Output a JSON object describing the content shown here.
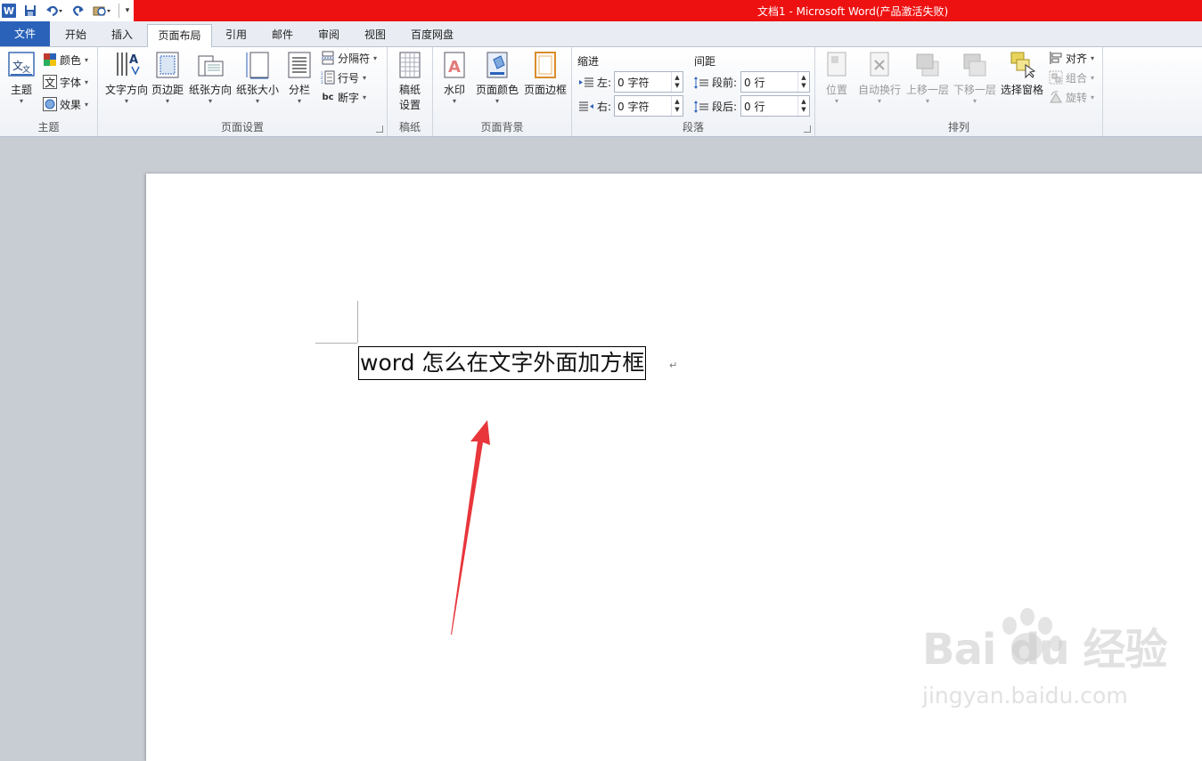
{
  "window": {
    "title": "文档1 - Microsoft Word(产品激活失败)"
  },
  "quick_access": {
    "app_icon": "W",
    "icons": [
      "save-icon",
      "undo-icon",
      "redo-icon",
      "print-preview-icon",
      "customize-icon"
    ]
  },
  "tabs": [
    {
      "label": "文件"
    },
    {
      "label": "开始"
    },
    {
      "label": "插入"
    },
    {
      "label": "页面布局"
    },
    {
      "label": "引用"
    },
    {
      "label": "邮件"
    },
    {
      "label": "审阅"
    },
    {
      "label": "视图"
    },
    {
      "label": "百度网盘"
    }
  ],
  "ribbon": {
    "theme_group": {
      "label": "主题",
      "theme_button": "主题",
      "colors": "颜色",
      "fonts": "字体",
      "effects": "效果"
    },
    "page_setup_group": {
      "label": "页面设置",
      "text_direction": "文字方向",
      "margins": "页边距",
      "orientation": "纸张方向",
      "size": "纸张大小",
      "columns": "分栏",
      "breaks": "分隔符",
      "line_numbers": "行号",
      "hyphenation": "断字",
      "hyphenation_icon_text": "bc"
    },
    "manuscript_group": {
      "label": "稿纸",
      "settings_line1": "稿纸",
      "settings_line2": "设置"
    },
    "page_background_group": {
      "label": "页面背景",
      "watermark": "水印",
      "page_color": "页面颜色",
      "page_borders": "页面边框"
    },
    "paragraph_group": {
      "label": "段落",
      "indent_label": "缩进",
      "spacing_label": "间距",
      "indent_left_label": "左:",
      "indent_left_value": "0 字符",
      "indent_right_label": "右:",
      "indent_right_value": "0 字符",
      "spacing_before_label": "段前:",
      "spacing_before_value": "0 行",
      "spacing_after_label": "段后:",
      "spacing_after_value": "0 行"
    },
    "arrange_group": {
      "label": "排列",
      "position": "位置",
      "wrap_text": "自动换行",
      "bring_forward": "上移一层",
      "send_backward": "下移一层",
      "selection_pane": "选择窗格",
      "align": "对齐",
      "group": "组合",
      "rotate": "旋转"
    }
  },
  "document": {
    "text": "word 怎么在文字外面加方框",
    "paragraph_mark": "↵"
  },
  "watermark": {
    "logo": "Bai du 经验",
    "url": "jingyan.baidu.com"
  },
  "colors": {
    "title_bar": "#ee1111",
    "file_tab": "#2a62b9",
    "arrow": "#e8363b"
  }
}
